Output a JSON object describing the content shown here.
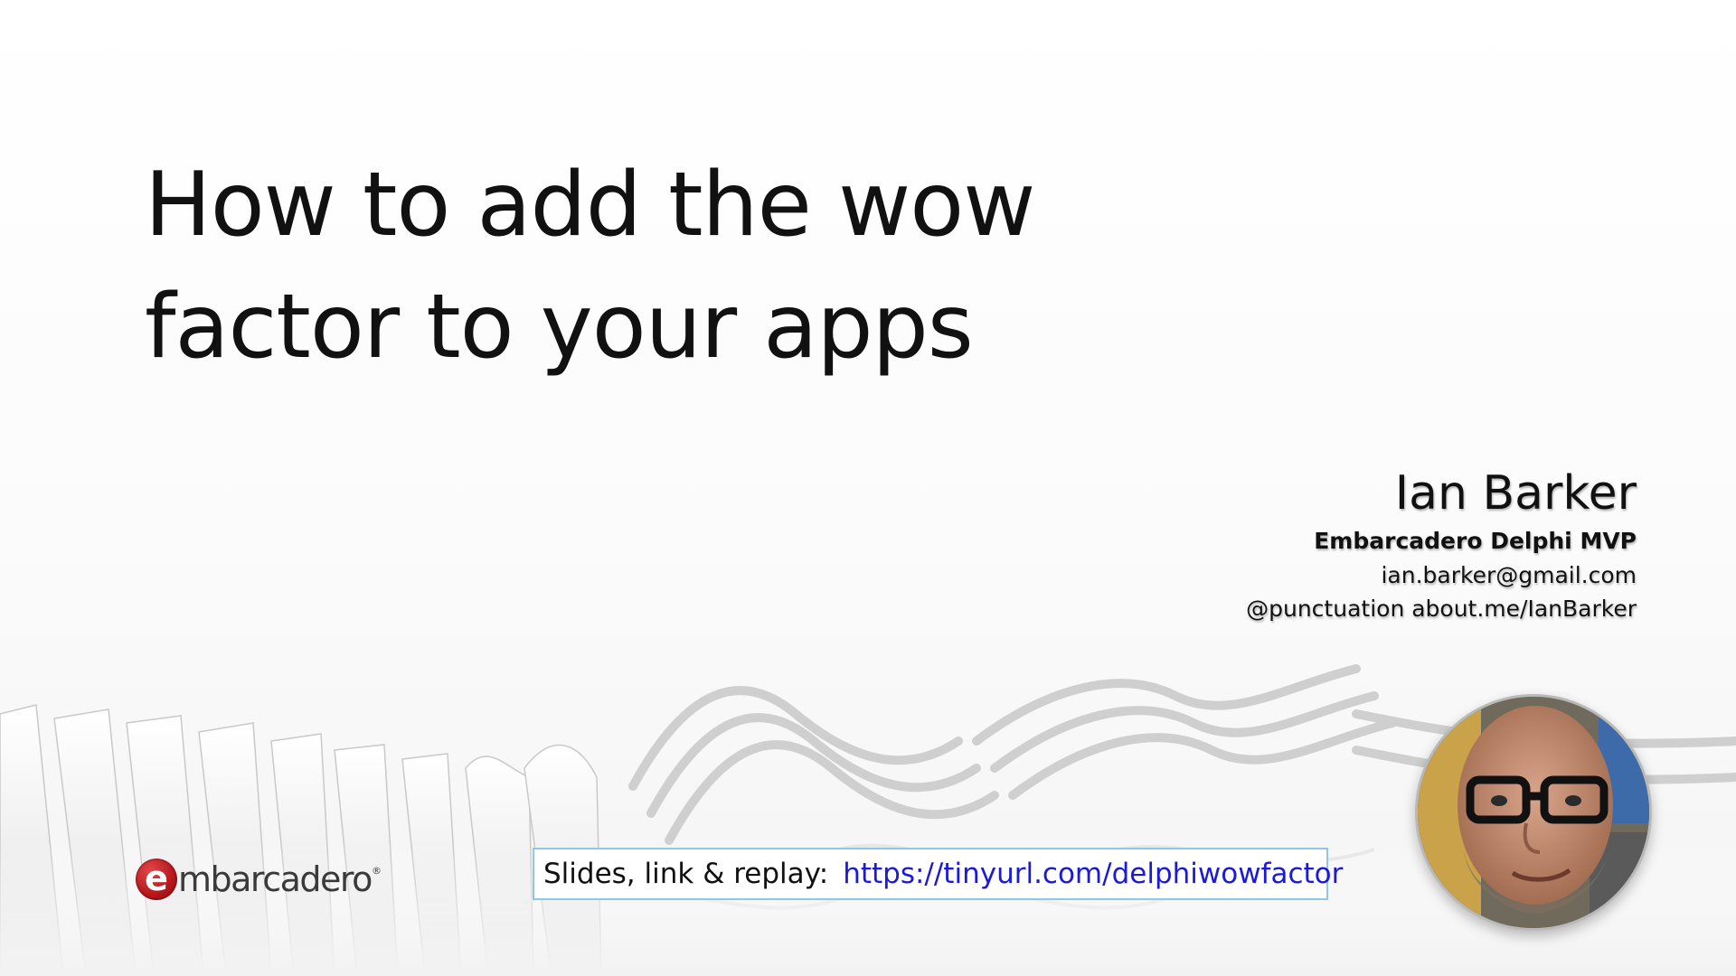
{
  "slide": {
    "title_line1": "How to add the wow",
    "title_line2": "factor to your apps"
  },
  "presenter": {
    "name": "Ian Barker",
    "role": "Embarcadero Delphi MVP",
    "email": "ian.barker@gmail.com",
    "social": "@punctuation about.me/IanBarker"
  },
  "footer": {
    "logo_mark": "e",
    "logo_text": "mbarcadero",
    "logo_registered": "®",
    "link_label": "Slides, link & replay:",
    "link_url": "https://tinyurl.com/delphiwowfactor"
  },
  "colors": {
    "link": "#1a1ad8",
    "link_box_border": "#8fc8e6",
    "logo_red": "#b5161c"
  }
}
